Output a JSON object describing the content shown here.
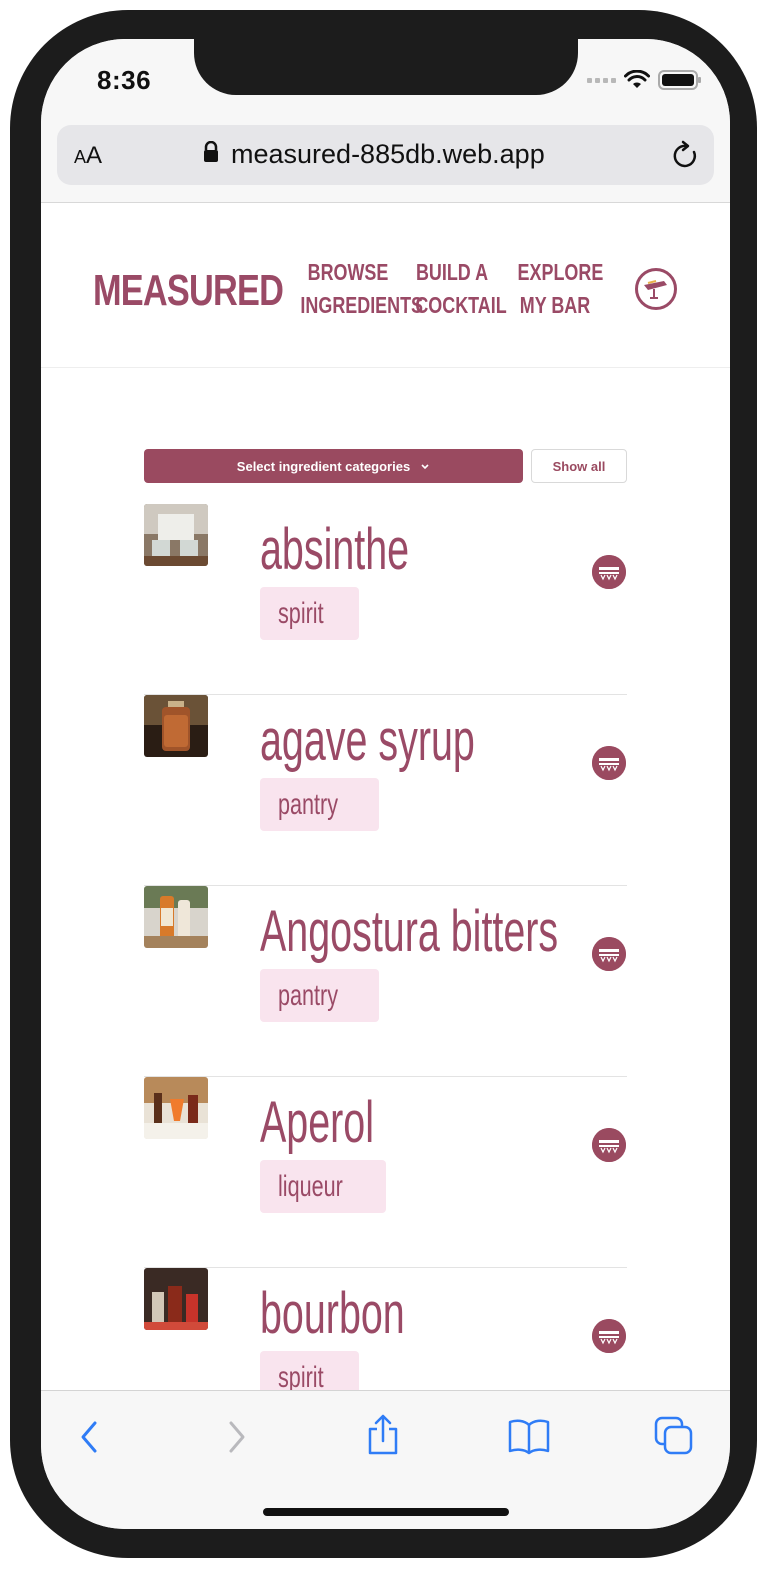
{
  "status": {
    "time": "8:36"
  },
  "browser": {
    "text_size_label_small": "A",
    "text_size_label_large": "A",
    "url": "measured-885db.web.app",
    "icons": [
      "lock-icon",
      "reload-icon",
      "back-icon",
      "forward-icon",
      "share-icon",
      "bookmarks-icon",
      "tabs-icon"
    ]
  },
  "header": {
    "logo": "MEASURED",
    "nav": [
      {
        "line1": "BROWSE",
        "line2": "INGREDIENTS"
      },
      {
        "line1": "BUILD A",
        "line2": "COCKTAIL"
      },
      {
        "line1": "EXPLORE",
        "line2": "MY BAR"
      }
    ],
    "user_icon": "bar-stool-avatar-icon"
  },
  "filters": {
    "select_label": "Select ingredient categories",
    "show_all_label": "Show all"
  },
  "ingredients": [
    {
      "name": "absinthe",
      "category": "spirit"
    },
    {
      "name": "agave syrup",
      "category": "pantry"
    },
    {
      "name": "Angostura bitters",
      "category": "pantry"
    },
    {
      "name": "Aperol",
      "category": "liqueur"
    },
    {
      "name": "bourbon",
      "category": "spirit"
    }
  ],
  "colors": {
    "brand": "#9a4a66",
    "tag_bg": "#f9e4ee",
    "filter_bg": "#9a4a60",
    "safari_blue": "#2f7cf6"
  }
}
